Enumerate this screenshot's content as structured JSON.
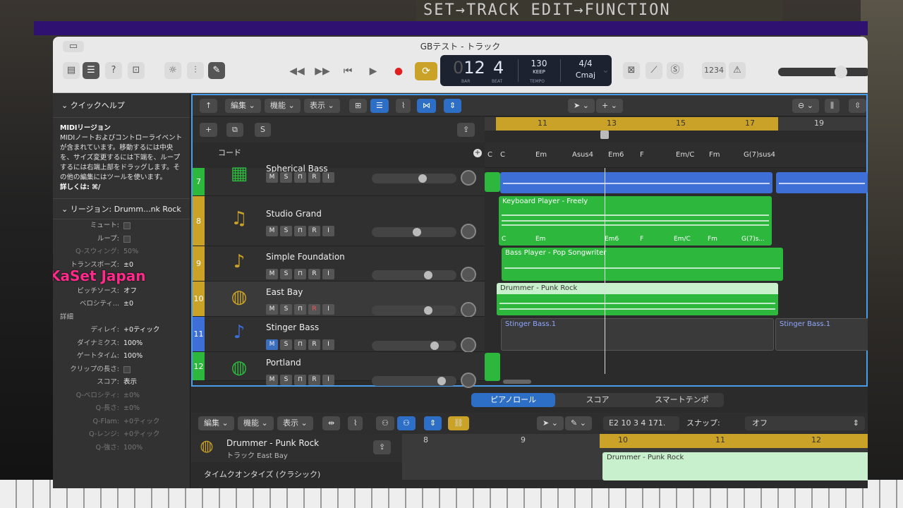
{
  "window": {
    "title": "GBテスト - トラック"
  },
  "lcd": {
    "bar": "12",
    "bar_prefix": "0",
    "beat": "4",
    "bar_label": "BAR",
    "beat_label": "BEAT",
    "tempo": "130",
    "tempo_mode": "KEEP",
    "tempo_label": "TEMPO",
    "time_sig": "4/4",
    "key": "Cmaj"
  },
  "toolbar": {
    "count_in": "1234"
  },
  "background": {
    "sign_text": "SET→TRACK EDIT→FUNCTION"
  },
  "left_panel": {
    "quick_help_title": "クイックヘルプ",
    "help_heading": "MIDIリージョン",
    "help_body": "MIDIノートおよびコントローライベントが含まれています。移動するには中央を、サイズ変更するには下端を、ループするには右端上部をドラッグします。その他の編集にはツールを使います。",
    "help_more": "詳しくは: ⌘/",
    "region_title": "リージョン: Drumm...nk Rock",
    "overlay": "KaSet Japan",
    "props": [
      {
        "k": "ミュート:",
        "v": "",
        "type": "check"
      },
      {
        "k": "ループ:",
        "v": "",
        "type": "check"
      },
      {
        "k": "Q-スウィング:",
        "v": "50%",
        "dim": true
      },
      {
        "k": "トランスポーズ:",
        "v": "±0"
      },
      {
        "k": "",
        "v": "-"
      },
      {
        "k": "ピッチソース:",
        "v": "オフ"
      },
      {
        "k": "ベロシティ...",
        "v": "±0"
      },
      {
        "k": "詳細",
        "v": "",
        "section": true
      },
      {
        "k": "ディレイ:",
        "v": "+0ティック"
      },
      {
        "k": "ダイナミクス:",
        "v": "100%"
      },
      {
        "k": "ゲートタイム:",
        "v": "100%"
      },
      {
        "k": "クリップの長さ:",
        "v": "",
        "type": "check"
      },
      {
        "k": "スコア:",
        "v": "表示"
      },
      {
        "k": "Q-ベロシティ:",
        "v": "±0%",
        "dim": true
      },
      {
        "k": "Q-長さ:",
        "v": "±0%",
        "dim": true
      },
      {
        "k": "Q-Flam:",
        "v": "+0ティック",
        "dim": true
      },
      {
        "k": "Q-レンジ:",
        "v": "+0ティック",
        "dim": true
      },
      {
        "k": "Q-強さ:",
        "v": "100%",
        "dim": true
      }
    ]
  },
  "main_toolbar": {
    "edit": "編集",
    "func": "機能",
    "view": "表示"
  },
  "header": {
    "solo": "S",
    "chord_label": "コード"
  },
  "ruler": [
    "11",
    "13",
    "15",
    "17",
    "19"
  ],
  "chords": [
    "C",
    "C",
    "Em",
    "Asus4",
    "Em6",
    "F",
    "Em/C",
    "Fm",
    "G(7)sus4"
  ],
  "tracks": [
    {
      "num": "7",
      "name": "Spherical Bass",
      "color": "#2db83d",
      "icon": "keys-icon",
      "glyph": "▦",
      "slider": 0.62
    },
    {
      "num": "8",
      "name": "Studio Grand",
      "color": "#c9a227",
      "icon": "piano-icon",
      "glyph": "♫",
      "slider": 0.55
    },
    {
      "num": "9",
      "name": "Simple Foundation",
      "color": "#c9a227",
      "icon": "bass-guitar-icon",
      "glyph": "♪",
      "slider": 0.7
    },
    {
      "num": "10",
      "name": "East Bay",
      "color": "#c9a227",
      "icon": "drum-kit-icon",
      "glyph": "◍",
      "slider": 0.7
    },
    {
      "num": "11",
      "name": "Stinger Bass",
      "color": "#3e6fd6",
      "icon": "bass-guitar-icon",
      "glyph": "♪",
      "slider": 0.78
    },
    {
      "num": "12",
      "name": "Portland",
      "color": "#2db83d",
      "icon": "drum-kit-icon",
      "glyph": "◍",
      "slider": 0.88
    }
  ],
  "regions": {
    "keyboard": "Keyboard Player - Freely",
    "keyboard_chords": [
      "C",
      "Em",
      "Em6",
      "F",
      "Em/C",
      "Fm",
      "G(7)s..."
    ],
    "bass": "Bass Player - Pop Songwriter",
    "drummer": "Drummer - Punk Rock",
    "stinger1": "Stinger Bass.1",
    "stinger2": "Stinger Bass.1"
  },
  "bottom": {
    "tabs": [
      "ピアノロール",
      "スコア",
      "スマートテンポ"
    ],
    "edit": "編集",
    "func": "機能",
    "view": "表示",
    "position": "E2  10 3 4 171.",
    "snap_label": "スナップ:",
    "snap_value": "オフ",
    "region_name": "Drummer - Punk Rock",
    "track_sub": "トラック East Bay",
    "ruler": [
      "8",
      "9",
      "10",
      "11",
      "12"
    ],
    "quantize": "タイムクオンタイズ (クラシック)"
  }
}
